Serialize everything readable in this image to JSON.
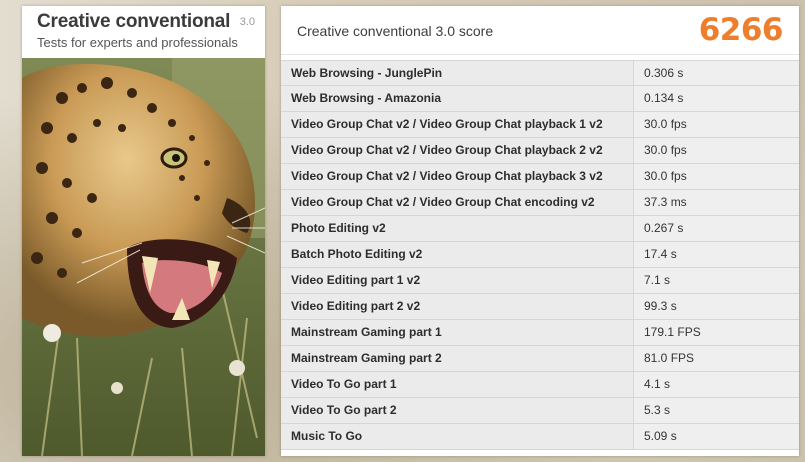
{
  "test": {
    "title": "Creative conventional",
    "version": "3.0",
    "subtitle": "Tests for experts and professionals"
  },
  "score": {
    "label": "Creative conventional 3.0 score",
    "value": "6266"
  },
  "results": [
    {
      "name": "Web Browsing - JunglePin",
      "value": "0.306 s"
    },
    {
      "name": "Web Browsing - Amazonia",
      "value": "0.134 s"
    },
    {
      "name": "Video Group Chat v2 / Video Group Chat playback 1 v2",
      "value": "30.0 fps"
    },
    {
      "name": "Video Group Chat v2 / Video Group Chat playback 2 v2",
      "value": "30.0 fps"
    },
    {
      "name": "Video Group Chat v2 / Video Group Chat playback 3 v2",
      "value": "30.0 fps"
    },
    {
      "name": "Video Group Chat v2 / Video Group Chat encoding v2",
      "value": "37.3 ms"
    },
    {
      "name": "Photo Editing v2",
      "value": "0.267 s"
    },
    {
      "name": "Batch Photo Editing v2",
      "value": "17.4 s"
    },
    {
      "name": "Video Editing part 1 v2",
      "value": "7.1 s"
    },
    {
      "name": "Video Editing part 2 v2",
      "value": "99.3 s"
    },
    {
      "name": "Mainstream Gaming part 1",
      "value": "179.1 FPS"
    },
    {
      "name": "Mainstream Gaming part 2",
      "value": "81.0 FPS"
    },
    {
      "name": "Video To Go part 1",
      "value": "4.1 s"
    },
    {
      "name": "Video To Go part 2",
      "value": "5.3 s"
    },
    {
      "name": "Music To Go",
      "value": "5.09 s"
    }
  ],
  "colors": {
    "score_accent": "#ee7d2c"
  },
  "image": {
    "subject": "leopard-photo"
  }
}
